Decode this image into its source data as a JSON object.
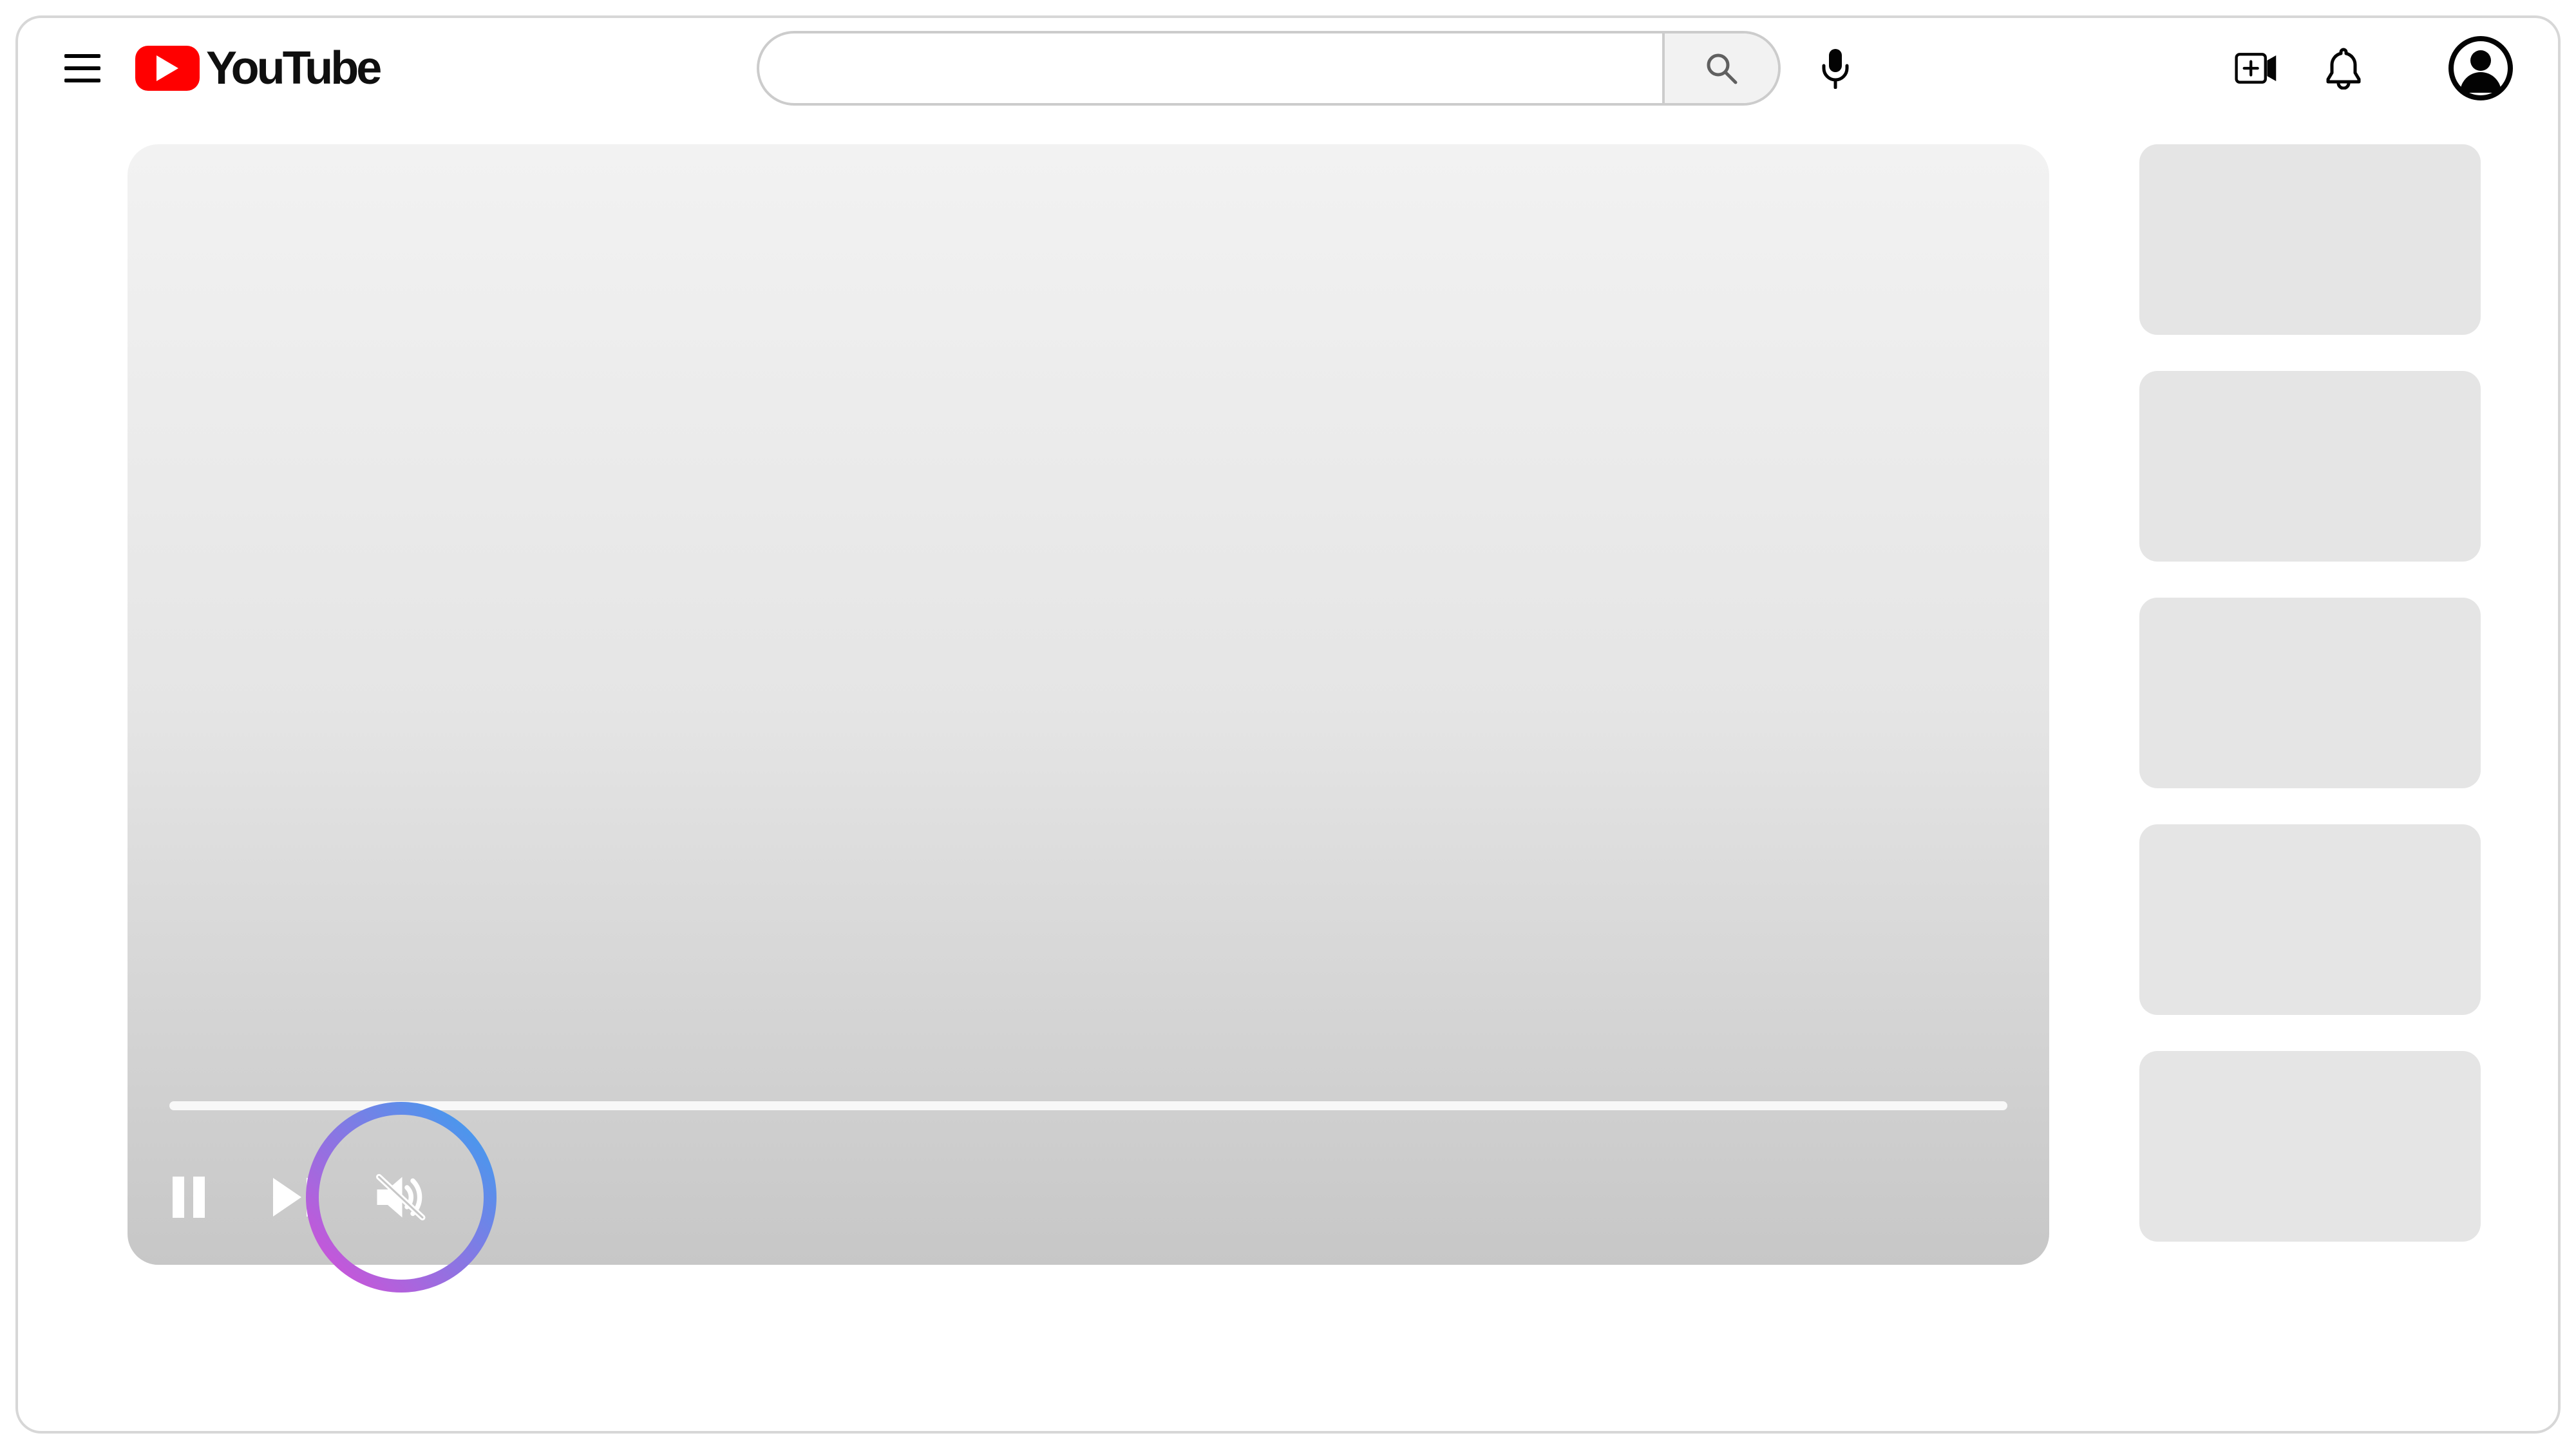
{
  "header": {
    "brand": "YouTube",
    "search_value": "",
    "search_placeholder": "",
    "icons": {
      "menu": "hamburger-menu-icon",
      "search": "search-icon",
      "mic": "microphone-icon",
      "create": "video-add-icon",
      "notifications": "bell-icon",
      "avatar": "user-avatar-icon"
    }
  },
  "player": {
    "controls": {
      "pause": "pause-icon",
      "next": "next-icon",
      "mute": "speaker-muted-icon"
    },
    "highlight_colors": {
      "start": "#d64ed6",
      "end": "#39a0f0"
    }
  },
  "sidebar": {
    "thumbnails": [
      null,
      null,
      null,
      null,
      null
    ]
  },
  "colors": {
    "accent": "#ff0000",
    "placeholder": "#e5e5e5"
  }
}
